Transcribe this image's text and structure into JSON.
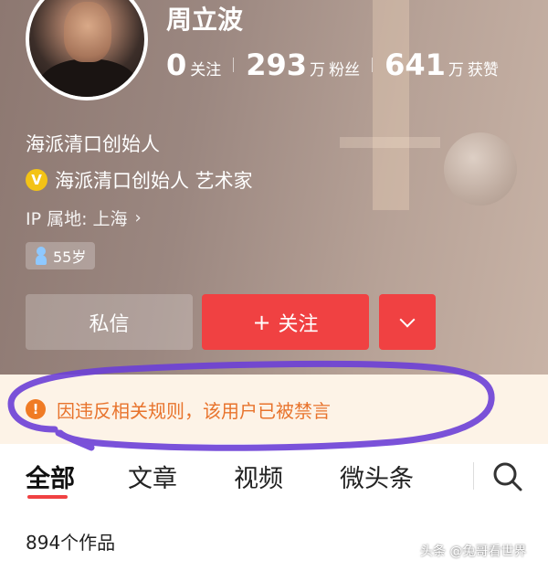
{
  "profile": {
    "name": "周立波",
    "bio": "海派清口创始人",
    "verify_badge": "V",
    "verification": "海派清口创始人 艺术家",
    "ip_location": "IP 属地: 上海",
    "ip_chevron": "›",
    "age": "55岁",
    "gender_icon": "male-icon"
  },
  "stats": [
    {
      "num": "0",
      "unit": "",
      "label": "关注"
    },
    {
      "num": "293",
      "unit": "万",
      "label": "粉丝"
    },
    {
      "num": "641",
      "unit": "万",
      "label": "获赞"
    }
  ],
  "actions": {
    "message_label": "私信",
    "follow_plus": "+",
    "follow_label": "关注",
    "more_icon": "chevron-down-icon"
  },
  "notice": {
    "icon_glyph": "!",
    "text": "因违反相关规则，该用户已被禁言",
    "annotation_color": "#6b3fd6"
  },
  "tabs": [
    {
      "label": "全部",
      "active": true
    },
    {
      "label": "文章",
      "active": false
    },
    {
      "label": "视频",
      "active": false
    },
    {
      "label": "微头条",
      "active": false
    }
  ],
  "works_count": "894个作品",
  "watermark": "头条 @兔哥看世界",
  "colors": {
    "accent": "#f04142",
    "warning": "#e8732c",
    "annotation": "#6b3fd6"
  }
}
